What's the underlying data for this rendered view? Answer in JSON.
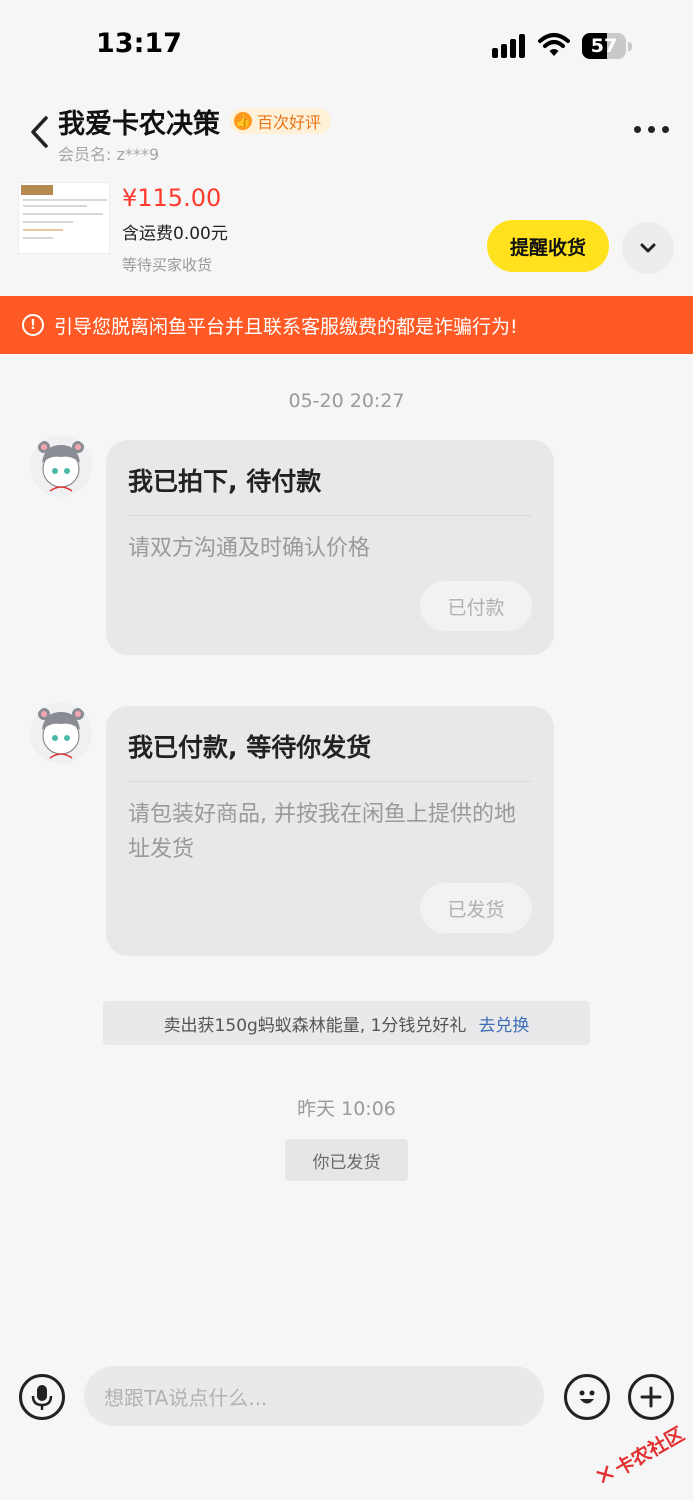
{
  "status_bar": {
    "time": "13:17",
    "battery": "57",
    "battery_level": 0.57
  },
  "header": {
    "title": "我爱卡农决策",
    "badge": "百次好评",
    "member": "会员名: z***9",
    "icons": {
      "back": "back-chevron-icon",
      "more": "more-dots-icon"
    }
  },
  "product": {
    "price": "¥115.00",
    "shipping": "含运费0.00元",
    "status": "等待买家收货",
    "remind_button": "提醒收货",
    "expand_icon": "chevron-down-icon"
  },
  "warning": {
    "text": "引导您脱离闲鱼平台并且联系客服缴费的都是诈骗行为!",
    "color": "#ff5a25"
  },
  "messages": [
    {
      "timestamp": "05-20 20:27",
      "title": "我已拍下, 待付款",
      "desc": "请双方沟通及时确认价格",
      "button": "已付款"
    },
    {
      "title": "我已付款, 等待你发货",
      "desc": "请包装好商品, 并按我在闲鱼上提供的地址发货",
      "button": "已发货"
    }
  ],
  "promo": {
    "text": "卖出获150g蚂蚁森林能量, 1分钱兑好礼",
    "link": "去兑换"
  },
  "timestamp2": "昨天 10:06",
  "system_notice": "你已发货",
  "input_bar": {
    "placeholder": "想跟TA说点什么..."
  },
  "watermark": {
    "text": "卡农社区"
  },
  "colors": {
    "accent_yellow": "#ffe21d",
    "price_red": "#ff3b30",
    "link_blue": "#3d6fb6"
  }
}
